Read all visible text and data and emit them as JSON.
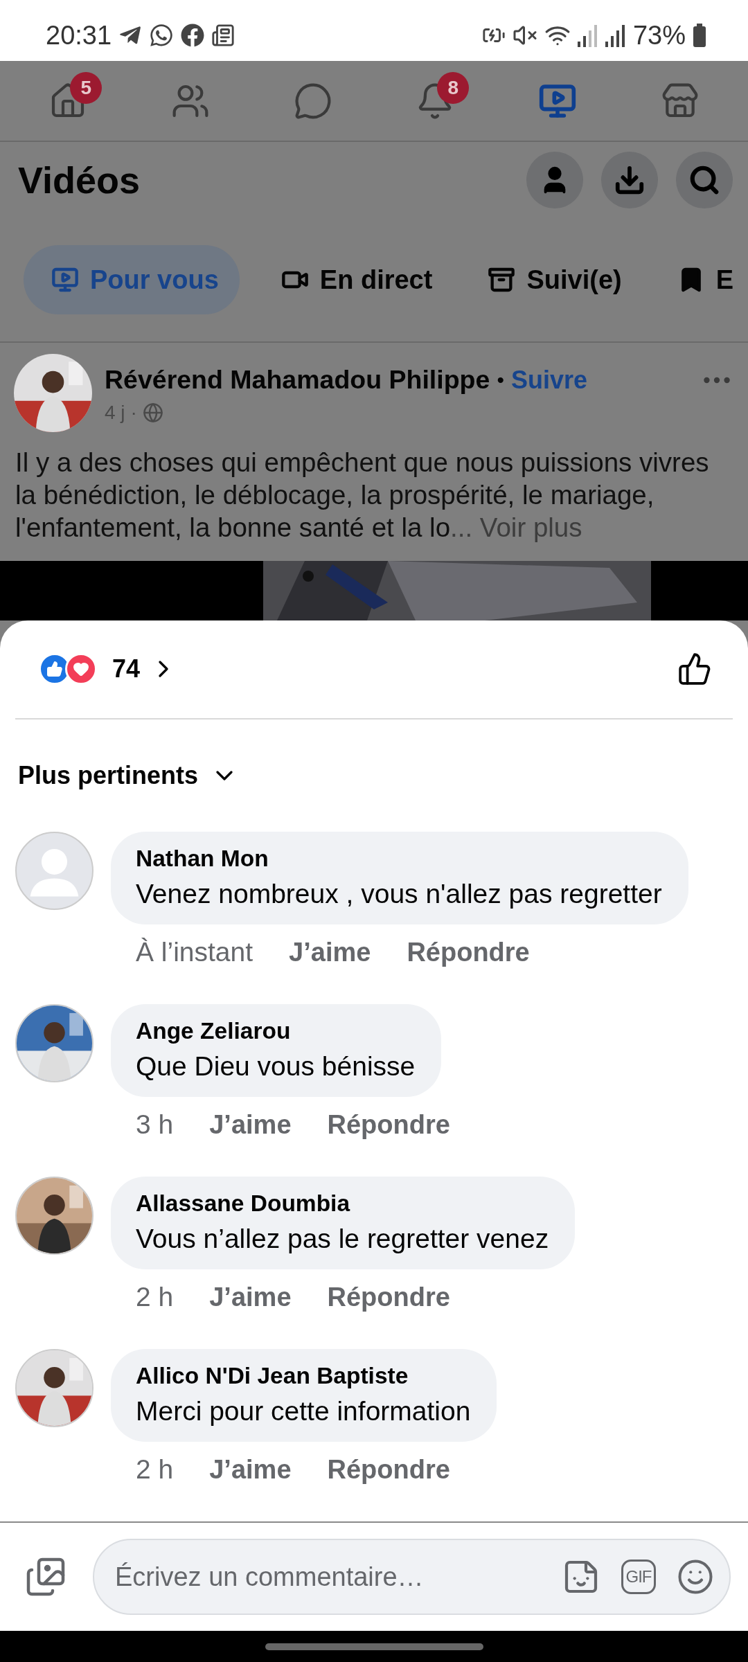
{
  "status_bar": {
    "time": "20:31",
    "battery": "73%"
  },
  "nav": [
    {
      "kind": "home",
      "badge": "5",
      "selected": false
    },
    {
      "kind": "friends",
      "selected": false
    },
    {
      "kind": "messenger",
      "selected": false
    },
    {
      "kind": "notifications",
      "badge": "8",
      "selected": false
    },
    {
      "kind": "video",
      "selected": true
    },
    {
      "kind": "marketplace",
      "selected": false
    }
  ],
  "header": {
    "title": "Vidéos"
  },
  "tabs": [
    {
      "kind": "for-you",
      "label": "Pour vous",
      "selected": true
    },
    {
      "kind": "live",
      "label": "En direct",
      "selected": false
    },
    {
      "kind": "following",
      "label": "Suivi(e)",
      "selected": false
    },
    {
      "kind": "saved",
      "label": "E",
      "selected": false
    }
  ],
  "post": {
    "author": "Révérend Mahamadou Philippe",
    "separator": "•",
    "follow": "Suivre",
    "age": "4 j",
    "dot": "·",
    "text": "Il y a des choses qui empêchent que nous puissions vivres la bénédiction, le déblocage, la prospérité, le mariage, l'enfantement, la bonne santé et la lo",
    "more": "... Voir plus"
  },
  "reactions": {
    "count": "74"
  },
  "sort": {
    "label": "Plus pertinents"
  },
  "comments": [
    {
      "kind": "default",
      "author": "Nathan Mon",
      "text": "Venez nombreux , vous n'allez pas regretter",
      "time": "À l’instant",
      "like": "J’aime",
      "reply": "Répondre"
    },
    {
      "kind": "picture",
      "author": "Ange Zeliarou",
      "text": "Que Dieu vous bénisse",
      "time": "3 h",
      "like": "J’aime",
      "reply": "Répondre"
    },
    {
      "kind": "picture",
      "author": "Allassane Doumbia",
      "text": "Vous n’allez pas le regretter venez",
      "time": "2 h",
      "like": "J’aime",
      "reply": "Répondre"
    },
    {
      "kind": "picture",
      "author": "Allico N'Di Jean Baptiste",
      "text": "Merci pour cette information",
      "time": "2 h",
      "like": "J’aime",
      "reply": "Répondre"
    }
  ],
  "composer": {
    "placeholder": "Écrivez un commentaire…",
    "gif": "GIF"
  }
}
